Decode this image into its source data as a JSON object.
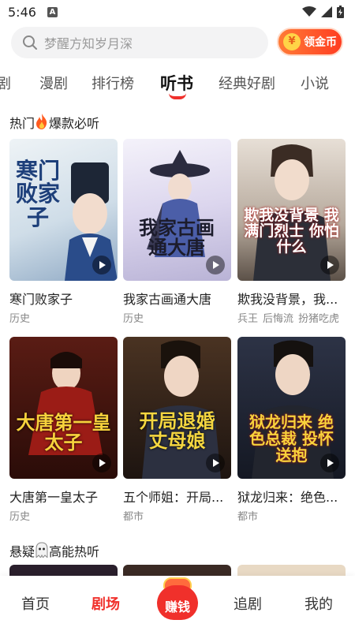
{
  "status": {
    "time": "5:46",
    "a_badge": "A"
  },
  "search": {
    "placeholder": "梦醒方知岁月深"
  },
  "coin_button": {
    "symbol": "¥",
    "label": "领金币"
  },
  "tabs": [
    {
      "label": "剧"
    },
    {
      "label": "漫剧"
    },
    {
      "label": "排行榜"
    },
    {
      "label": "听书"
    },
    {
      "label": "经典好剧"
    },
    {
      "label": "小说"
    }
  ],
  "sections": {
    "hot": {
      "title_pre": "热门",
      "title_post": "爆款必听"
    },
    "mystery": {
      "title_pre": "悬疑",
      "title_post": "高能热听"
    }
  },
  "books": [
    {
      "title": "寒门败家子",
      "tags": [
        "历史"
      ],
      "cover_text": "寒门败家子",
      "cover_bg": "#dfe8ee",
      "cover_fg": "#1d3f7a"
    },
    {
      "title": "我家古画通大唐",
      "tags": [
        "历史"
      ],
      "cover_text": "我家古画通大唐",
      "cover_bg": "#e9e6f3",
      "cover_fg": "#2a2a3c"
    },
    {
      "title": "欺我没背景，我...",
      "tags": [
        "兵王",
        "后悔流",
        "扮猪吃虎"
      ],
      "cover_text": "欺我没背景 我满门烈士 你怕什么",
      "cover_bg": "#c8c0b8",
      "cover_fg": "#ffffff"
    },
    {
      "title": "大唐第一皇太子",
      "tags": [
        "历史"
      ],
      "cover_text": "大唐第一皇太子",
      "cover_bg": "#3a1410",
      "cover_fg": "#f7d23c"
    },
    {
      "title": "五个师姐：开局...",
      "tags": [
        "都市"
      ],
      "cover_text": "开局退婚 丈母娘",
      "cover_bg": "#2b1e16",
      "cover_fg": "#f4d640"
    },
    {
      "title": "狱龙归来：绝色...",
      "tags": [
        "都市"
      ],
      "cover_text": "狱龙归来 绝色总裁 投怀送抱",
      "cover_bg": "#1c2130",
      "cover_fg": "#f7d23c"
    }
  ],
  "bottom_nav": [
    {
      "label": "首页"
    },
    {
      "label": "剧场"
    },
    {
      "label": "赚钱"
    },
    {
      "label": "追剧"
    },
    {
      "label": "我的"
    }
  ],
  "colors": {
    "accent": "#f0302b",
    "coin_start": "#ff7b36",
    "coin_end": "#ff3d22"
  }
}
